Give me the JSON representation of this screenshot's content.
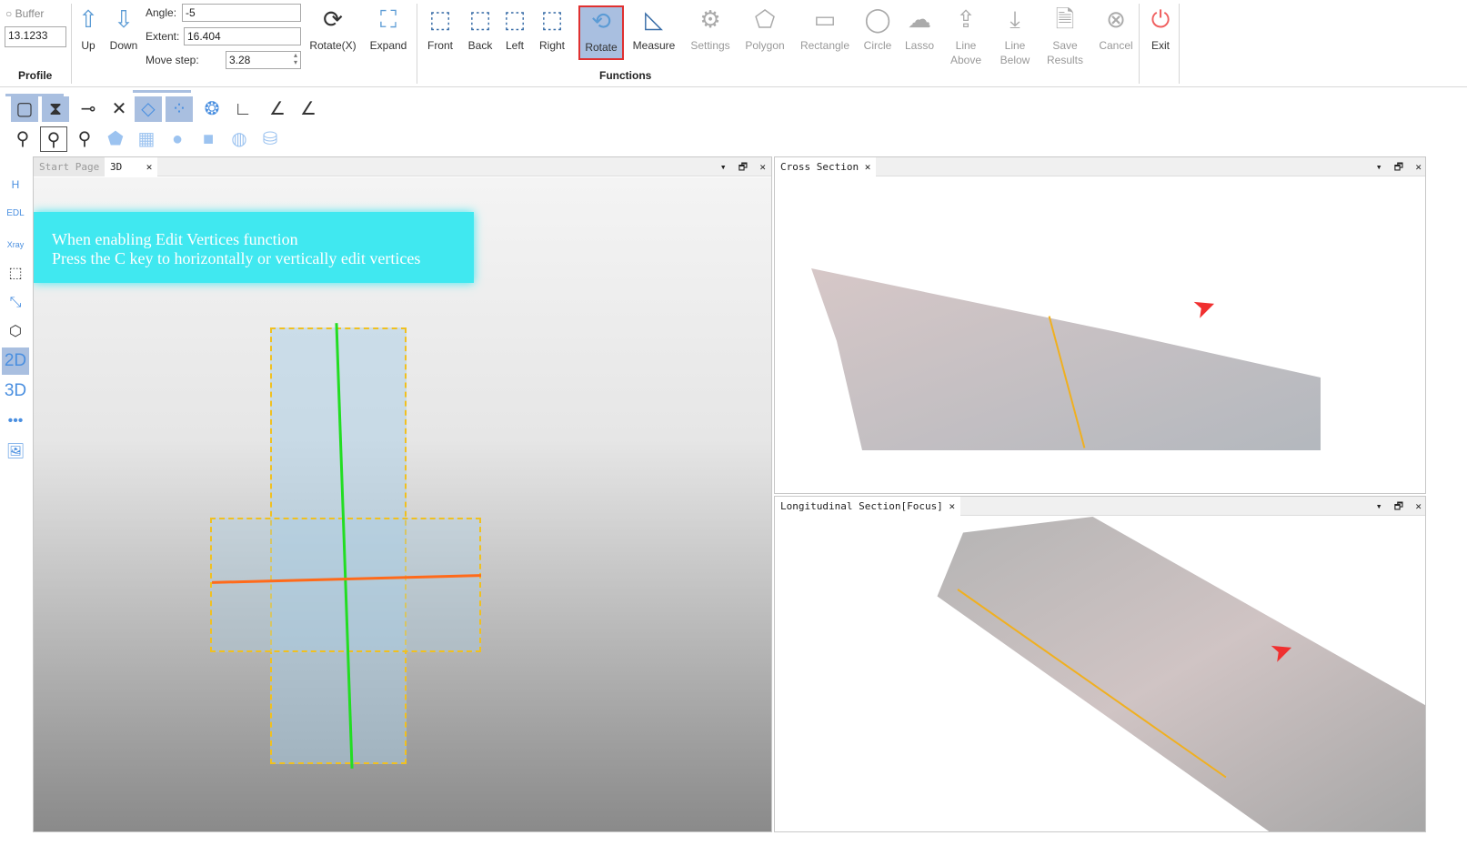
{
  "profile": {
    "buffer_label": "Buffer",
    "buffer_value": "13.1233",
    "group_title": "Profile",
    "up": "Up",
    "down": "Down",
    "angle_label": "Angle:",
    "angle_value": "-5",
    "extent_label": "Extent:",
    "extent_value": "16.404",
    "move_step_label": "Move step:",
    "move_step_value": "3.28",
    "rotate": "Rotate(X)",
    "expand": "Expand"
  },
  "functions": {
    "group_title": "Functions",
    "buttons": [
      {
        "label": "Front",
        "icon": "cube-front-icon"
      },
      {
        "label": "Back",
        "icon": "cube-back-icon"
      },
      {
        "label": "Left",
        "icon": "cube-left-icon"
      },
      {
        "label": "Right",
        "icon": "cube-right-icon"
      },
      {
        "label": "Rotate",
        "icon": "rotate-icon",
        "active": true
      },
      {
        "label": "Measure",
        "icon": "ruler-triangle-icon"
      },
      {
        "label": "Settings",
        "icon": "gear-icon",
        "disabled": true
      },
      {
        "label": "Polygon",
        "icon": "polygon-icon",
        "disabled": true
      },
      {
        "label": "Rectangle",
        "icon": "rectangle-icon",
        "disabled": true
      },
      {
        "label": "Circle",
        "icon": "circle-icon",
        "disabled": true
      },
      {
        "label": "Lasso",
        "icon": "lasso-icon",
        "disabled": true
      },
      {
        "label": "Line Above",
        "icon": "upload-icon",
        "disabled": true
      },
      {
        "label": "Line Below",
        "icon": "download-icon",
        "disabled": true
      },
      {
        "label": "Save Results",
        "icon": "save-icon",
        "disabled": true
      },
      {
        "label": "Cancel",
        "icon": "cancel-circle-icon",
        "disabled": true
      }
    ],
    "exit": "Exit"
  },
  "tabs": {
    "main": [
      {
        "label": "Start Page"
      },
      {
        "label": "3D"
      }
    ],
    "cross": "Cross Section",
    "longitudinal": "Longitudinal Section[Focus]"
  },
  "sidebar": [
    "H",
    "EDL",
    "Xray",
    "box",
    "expand",
    "cube",
    "2D",
    "3D",
    "more",
    "image"
  ],
  "notice": {
    "line1": "When enabling Edit Vertices function",
    "line2": "Press the C key to horizontally or vertically edit vertices"
  },
  "colors": {
    "accent": "#5b9bd5",
    "selected": "#a9bfe0",
    "active_outline": "#e03030",
    "notice_bg": "#40e8f0",
    "section_orange": "#ff6a1a",
    "section_green": "#22dd22"
  }
}
